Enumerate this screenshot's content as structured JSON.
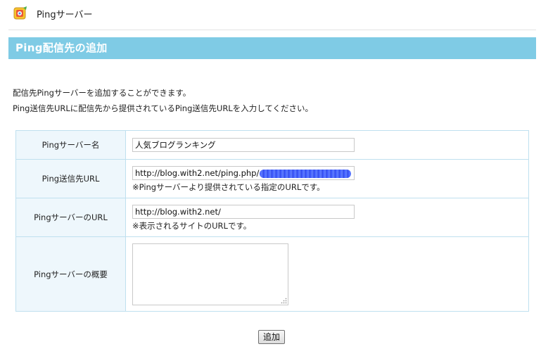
{
  "app": {
    "title": "Pingサーバー",
    "icon": "ping-app-icon"
  },
  "section": {
    "title": "Ping配信先の追加"
  },
  "description": {
    "line1": "配信先Pingサーバーを追加することができます。",
    "line2": "Ping送信先URLに配信先から提供されているPing送信先URLを入力してください。"
  },
  "form": {
    "fields": [
      {
        "label": "Pingサーバー名",
        "value": "人気ブログランキング"
      },
      {
        "label": "Ping送信先URL",
        "value": "http://blog.with2.net/ping.php/",
        "note": "※Pingサーバーより提供されている指定のURLです。"
      },
      {
        "label": "PingサーバーのURL",
        "value": "http://blog.with2.net/",
        "note": "※表示されるサイトのURLです。"
      },
      {
        "label": "Pingサーバーの概要",
        "value": ""
      }
    ]
  },
  "buttons": {
    "submit": "追加"
  },
  "colors": {
    "header_bg": "#7fcbe5",
    "label_bg": "#eef7fc",
    "border": "#bfe0ef"
  }
}
